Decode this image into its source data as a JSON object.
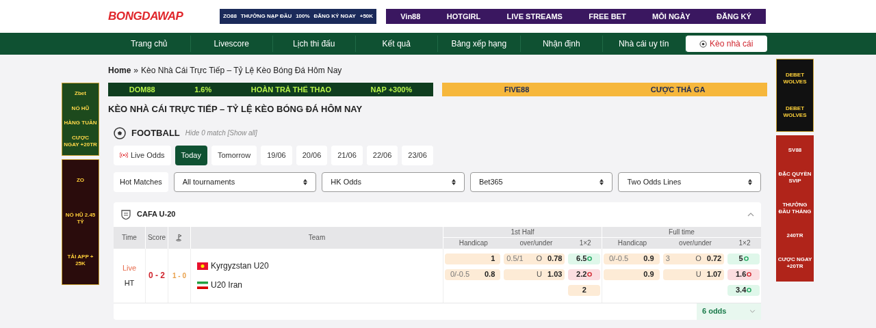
{
  "logo": "BONGDAWAP",
  "top_banners": [
    {
      "kind": "zo88",
      "texts": [
        "ZO88",
        "THƯỞNG NẠP ĐẦU",
        "100%",
        "ĐĂNG KÝ NGAY",
        "+50K"
      ]
    },
    {
      "kind": "vin88",
      "texts": [
        "Vin88",
        "HOTGIRL",
        "LIVE STREAMS",
        "FREE BET",
        "MỖI NGÀY",
        "ĐĂNG KÝ"
      ]
    }
  ],
  "nav": [
    {
      "label": "Trang chủ",
      "selected": false
    },
    {
      "label": "Livescore",
      "selected": false
    },
    {
      "label": "Lịch thi đấu",
      "selected": false
    },
    {
      "label": "Kết quả",
      "selected": false
    },
    {
      "label": "Bảng xếp hạng",
      "selected": false
    },
    {
      "label": "Nhận định",
      "selected": false
    },
    {
      "label": "Nhà cái uy tín",
      "selected": false
    },
    {
      "label": "Kèo nhà cái",
      "selected": true
    }
  ],
  "breadcrumb": [
    "Home",
    "»",
    "Kèo Nhà Cái Trực Tiếp – Tỷ Lệ Kèo Bóng Đá Hôm Nay"
  ],
  "side_left": [
    {
      "kind": "zbet",
      "texts": [
        "Zbet",
        "NỔ HŨ",
        "HÀNG TUẦN",
        "CƯỢC NGAY +20TR"
      ]
    },
    {
      "kind": "zo",
      "texts": [
        "ZO",
        "NỔ HŨ 2.45 TỶ",
        "TẢI APP + 25K"
      ]
    }
  ],
  "side_right": [
    {
      "kind": "debet",
      "texts": [
        "DEBET WOLVES",
        "DEBET WOLVES"
      ]
    },
    {
      "kind": "sv88",
      "texts": [
        "SV88",
        "ĐẶC QUYỀN SVIP",
        "THƯỞNG ĐẦU THÁNG",
        "240TR",
        "CƯỢC NGAY +20TR"
      ]
    }
  ],
  "content_banners": [
    {
      "kind": "dom88",
      "texts": [
        "DOM88",
        "1.6%",
        "HOÀN TRẢ THỂ THAO",
        "NẠP +300%"
      ]
    },
    {
      "kind": "five88",
      "texts": [
        "FIVE88",
        "CƯỢC THẢ GA"
      ]
    }
  ],
  "page_title": "KÈO NHÀ CÁI TRỰC TIẾP – TỶ LỆ KÈO BÓNG ĐÁ HÔM NAY",
  "sport": {
    "title": "FOOTBALL",
    "hide_note": "Hide *0* match [Show all]"
  },
  "date_tabs": [
    {
      "label": "Live Odds",
      "kind": "live",
      "selected": false
    },
    {
      "label": "Today",
      "kind": "date",
      "selected": true
    },
    {
      "label": "Tomorrow",
      "kind": "date",
      "selected": false
    },
    {
      "label": "19/06",
      "kind": "date",
      "selected": false
    },
    {
      "label": "20/06",
      "kind": "date",
      "selected": false
    },
    {
      "label": "21/06",
      "kind": "date",
      "selected": false
    },
    {
      "label": "22/06",
      "kind": "date",
      "selected": false
    },
    {
      "label": "23/06",
      "kind": "date",
      "selected": false
    }
  ],
  "hot_matches": "Hot Matches",
  "filters": [
    "All tournaments",
    "HK Odds",
    "Bet365",
    "Two Odds Lines"
  ],
  "league": {
    "name": "CAFA U-20",
    "expanded": true,
    "headers": {
      "time": "Time",
      "score": "Score",
      "team": "Team",
      "first_half": "1st Half",
      "full_time": "Full time",
      "first_half_cols": [
        "Handicap",
        "over/under",
        "1×2"
      ],
      "full_time_cols": [
        "Handicap",
        "over/under",
        "1×2"
      ]
    },
    "match": {
      "status": "Live",
      "period": "HT",
      "score": "0 - 2",
      "half_score": "1 - 0",
      "teams": [
        {
          "name": "Kyrgyzstan U20",
          "kind": "kyrgyzstan"
        },
        {
          "name": "U20 Iran",
          "kind": "iran"
        }
      ],
      "lines": [
        {
          "fh_hc": {
            "value": "1"
          },
          "fh_ou": {
            "line": "0.5/1",
            "side": "O",
            "value": "0.78"
          },
          "fh_x12": {
            "value": "6.5",
            "kind": "up"
          },
          "ft_hc": {
            "line": "0/-0.5",
            "value": "0.9"
          },
          "ft_ou": {
            "line": "3",
            "side": "O",
            "value": "0.72"
          },
          "ft_x12": {
            "value": "5",
            "kind": "up"
          }
        },
        {
          "fh_hc": {
            "line": "0/-0.5",
            "value": "0.8"
          },
          "fh_ou": {
            "side": "U",
            "value": "1.03"
          },
          "fh_x12": {
            "value": "2.2",
            "kind": "down"
          },
          "ft_hc": {
            "value": "0.9"
          },
          "ft_ou": {
            "side": "U",
            "value": "1.07"
          },
          "ft_x12": {
            "value": "1.6",
            "kind": "down"
          }
        },
        {
          "fh_x12": {
            "value": "2",
            "kind": "plain"
          },
          "ft_x12": {
            "value": "3.4",
            "kind": "up"
          }
        }
      ]
    },
    "more_odds": "6 odds"
  }
}
